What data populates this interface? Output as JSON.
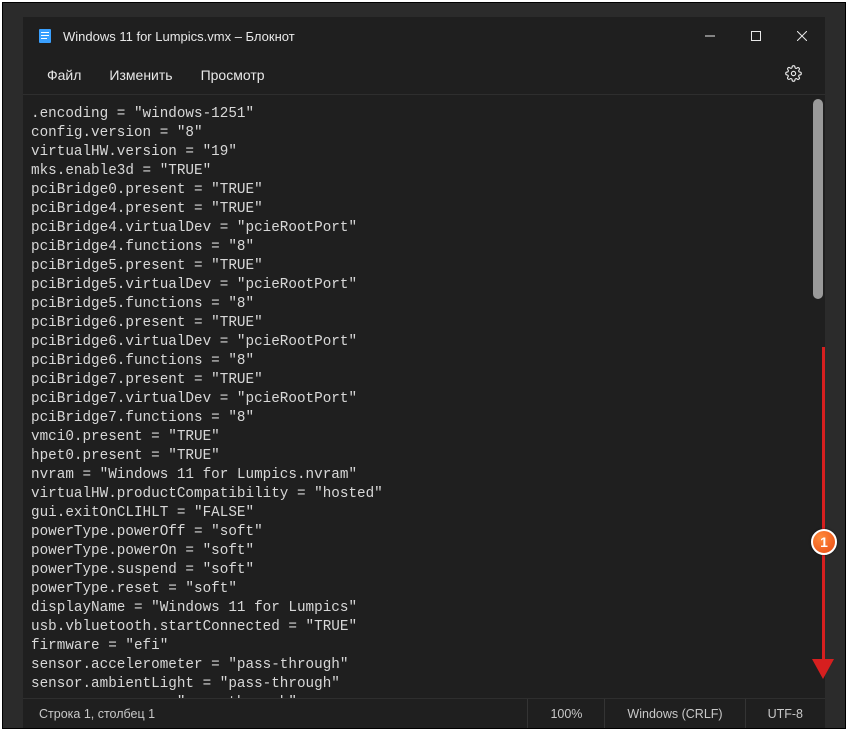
{
  "titlebar": {
    "title": "Windows 11 for Lumpics.vmx – Блокнот"
  },
  "menu": {
    "file": "Файл",
    "edit": "Изменить",
    "view": "Просмотр"
  },
  "annotation": {
    "badge": "1"
  },
  "status": {
    "position": "Строка 1, столбец 1",
    "zoom": "100%",
    "eol": "Windows (CRLF)",
    "encoding": "UTF-8"
  },
  "content": ".encoding = \"windows-1251\"\nconfig.version = \"8\"\nvirtualHW.version = \"19\"\nmks.enable3d = \"TRUE\"\npciBridge0.present = \"TRUE\"\npciBridge4.present = \"TRUE\"\npciBridge4.virtualDev = \"pcieRootPort\"\npciBridge4.functions = \"8\"\npciBridge5.present = \"TRUE\"\npciBridge5.virtualDev = \"pcieRootPort\"\npciBridge5.functions = \"8\"\npciBridge6.present = \"TRUE\"\npciBridge6.virtualDev = \"pcieRootPort\"\npciBridge6.functions = \"8\"\npciBridge7.present = \"TRUE\"\npciBridge7.virtualDev = \"pcieRootPort\"\npciBridge7.functions = \"8\"\nvmci0.present = \"TRUE\"\nhpet0.present = \"TRUE\"\nnvram = \"Windows 11 for Lumpics.nvram\"\nvirtualHW.productCompatibility = \"hosted\"\ngui.exitOnCLIHLT = \"FALSE\"\npowerType.powerOff = \"soft\"\npowerType.powerOn = \"soft\"\npowerType.suspend = \"soft\"\npowerType.reset = \"soft\"\ndisplayName = \"Windows 11 for Lumpics\"\nusb.vbluetooth.startConnected = \"TRUE\"\nfirmware = \"efi\"\nsensor.accelerometer = \"pass-through\"\nsensor.ambientLight = \"pass-through\"\nsensor.compass = \"pass-through\""
}
